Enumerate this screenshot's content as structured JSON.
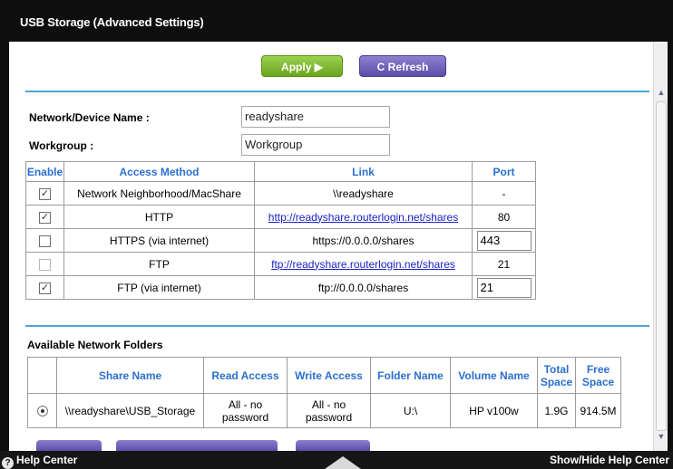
{
  "window": {
    "title": "USB Storage (Advanced Settings)"
  },
  "toolbar": {
    "apply_label": "Apply ▶",
    "refresh_label": "C Refresh"
  },
  "device": {
    "name_label": "Network/Device Name :",
    "name_value": "readyshare",
    "workgroup_label": "Workgroup :",
    "workgroup_value": "Workgroup"
  },
  "access_table": {
    "headers": [
      "Enable",
      "Access Method",
      "Link",
      "Port"
    ],
    "rows": [
      {
        "checked": true,
        "disabled": false,
        "method": "Network Neighborhood/MacShare",
        "link": "\\\\readyshare",
        "link_is_url": false,
        "port": "-",
        "port_editable": false
      },
      {
        "checked": true,
        "disabled": false,
        "method": "HTTP",
        "link": "http://readyshare.routerlogin.net/shares",
        "link_is_url": true,
        "port": "80",
        "port_editable": false
      },
      {
        "checked": false,
        "disabled": false,
        "method": "HTTPS (via internet)",
        "link": "https://0.0.0.0/shares",
        "link_is_url": false,
        "port": "443",
        "port_editable": true
      },
      {
        "checked": false,
        "disabled": true,
        "method": "FTP",
        "link": "ftp://readyshare.routerlogin.net/shares",
        "link_is_url": true,
        "port": "21",
        "port_editable": false
      },
      {
        "checked": true,
        "disabled": false,
        "method": "FTP (via internet)",
        "link": "ftp://0.0.0.0/shares",
        "link_is_url": false,
        "port": "21",
        "port_editable": true
      }
    ]
  },
  "folders": {
    "title": "Available Network Folders",
    "headers": [
      "",
      "Share Name",
      "Read Access",
      "Write Access",
      "Folder Name",
      "Volume Name",
      "Total Space",
      "Free Space"
    ],
    "rows": [
      {
        "selected": true,
        "share_name": "\\\\readyshare\\USB_Storage",
        "read_access": "All - no password",
        "write_access": "All - no password",
        "folder_name": "U:\\",
        "volume_name": "HP v100w",
        "total_space": "1.9G",
        "free_space": "914.5M"
      }
    ]
  },
  "helpbar": {
    "left_label": "Help Center",
    "right_label": "Show/Hide Help Center"
  },
  "colors": {
    "accent_rule": "#4aa3d8",
    "apply_green": "#7bb629",
    "refresh_purple": "#6b5cb8",
    "link_blue": "#1a22c6",
    "header_blue": "#2b6fd0"
  }
}
